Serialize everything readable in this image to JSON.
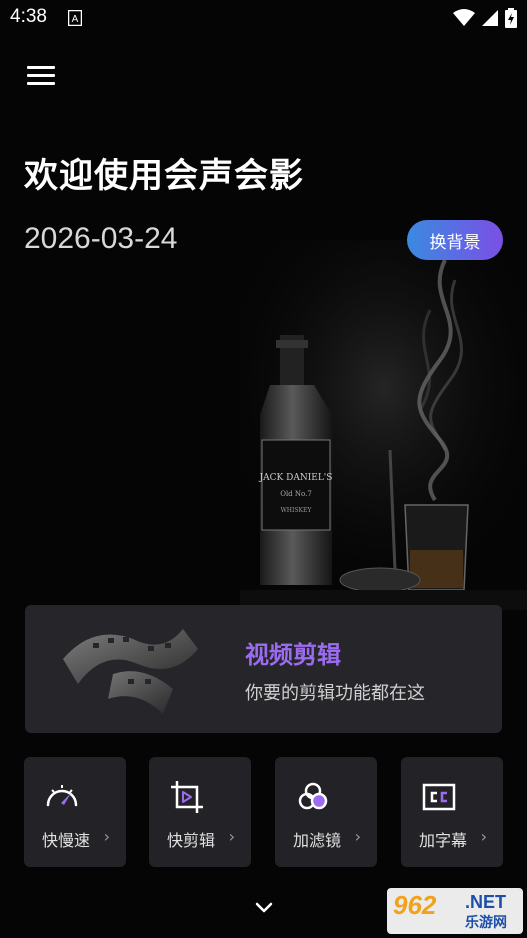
{
  "status_bar": {
    "time": "4:38",
    "notification_letter": "A"
  },
  "header": {
    "title": "欢迎使用会声会影",
    "date": "2026-03-24",
    "change_background_label": "换背景"
  },
  "feature_card": {
    "title": "视频剪辑",
    "subtitle": "你要的剪辑功能都在这"
  },
  "tools": [
    {
      "label": "快慢速",
      "icon": "speedometer-icon"
    },
    {
      "label": "快剪辑",
      "icon": "crop-play-icon"
    },
    {
      "label": "加滤镜",
      "icon": "filter-circles-icon"
    },
    {
      "label": "加字幕",
      "icon": "cc-subtitle-icon"
    }
  ],
  "tool_chevron": "›",
  "watermark": {
    "main": "962",
    "net": ".NET",
    "sub": "乐游网"
  },
  "colors": {
    "accent_purple": "#9c6cf0",
    "button_gradient_start": "#3a8ae0",
    "button_gradient_end": "#7b4fe6",
    "card_background": "#25252a"
  }
}
